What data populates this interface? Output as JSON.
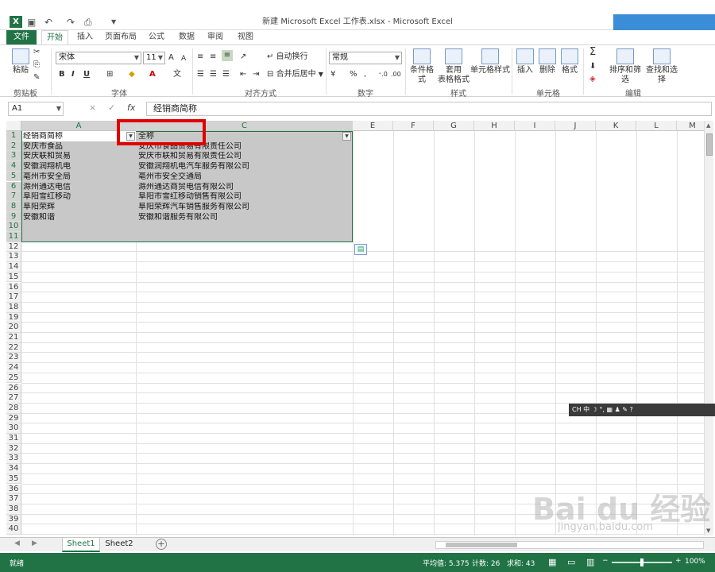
{
  "window": {
    "title": "新建 Microsoft Excel 工作表.xlsx - Microsoft Excel",
    "app_logo": "X"
  },
  "qat": {
    "save_icon": "save-icon",
    "undo_icon": "undo-icon",
    "redo_icon": "redo-icon",
    "menu_arrow": "▼"
  },
  "tabs": [
    "文件",
    "开始",
    "插入",
    "页面布局",
    "公式",
    "数据",
    "审阅",
    "视图"
  ],
  "ribbon": {
    "clipboard": {
      "paste": "粘贴",
      "label": "剪贴板"
    },
    "font": {
      "name": "宋体",
      "size": "11",
      "label": "字体",
      "bold": "B",
      "italic": "I",
      "underline": "U",
      "grow": "A",
      "shrink": "A"
    },
    "align": {
      "wrap": "自动换行",
      "merge": "合并后居中",
      "label": "对齐方式"
    },
    "number": {
      "format": "常规",
      "percent": "%",
      "comma": ",",
      "label": "数字"
    },
    "styles": {
      "cond": "条件格式",
      "table_line1": "套用",
      "table_line2": "表格格式",
      "cell": "单元格样式",
      "label": "样式"
    },
    "cells": {
      "insert": "插入",
      "delete": "删除",
      "format": "格式",
      "label": "单元格"
    },
    "editing": {
      "sum": "Σ",
      "sort": "排序和筛选",
      "find": "查找和选择",
      "label": "编辑"
    }
  },
  "formula_bar": {
    "name_box": "A1",
    "cancel": "×",
    "enter": "✓",
    "fx": "fx",
    "content": "经销商简称"
  },
  "columns": [
    "A",
    "C",
    "E",
    "F",
    "G",
    "H",
    "I",
    "J",
    "K",
    "L",
    "M"
  ],
  "rows": [
    "1",
    "2",
    "3",
    "4",
    "5",
    "6",
    "7",
    "8",
    "9",
    "10",
    "11",
    "12",
    "13",
    "14",
    "15",
    "16",
    "17",
    "18",
    "19",
    "20",
    "21",
    "22",
    "23",
    "24",
    "25",
    "26",
    "27",
    "28",
    "29",
    "30",
    "31",
    "32",
    "33",
    "34",
    "35",
    "36",
    "37",
    "38",
    "39",
    "40"
  ],
  "table": {
    "headers": [
      "经销商简称",
      "全称"
    ],
    "rows": [
      [
        "安庆市食品",
        "安庆市食品贸易有限责任公司"
      ],
      [
        "安庆联和贸易",
        "安庆市联和贸易有限责任公司"
      ],
      [
        "安徽润翔机电",
        "安徽润翔机电汽车服务有限公司"
      ],
      [
        "亳州市安全局",
        "亳州市安全交通局"
      ],
      [
        "滁州通达电信",
        "滁州通达商贸电信有限公司"
      ],
      [
        "阜阳雪红移动",
        "阜阳市雪红移动销售有限公司"
      ],
      [
        "阜阳荣辉",
        "阜阳荣辉汽车销售服务有限公司"
      ],
      [
        "安徽和谐",
        "安徽和谐服务有限公司"
      ]
    ]
  },
  "sheets": [
    "Sheet1",
    "Sheet2"
  ],
  "add_sheet": "+",
  "status": {
    "mode": "就绪",
    "average": "平均值: 5.375",
    "count": "计数: 26",
    "sum": "求和: 43",
    "zoom": "100%",
    "zoom_level": 1.0
  },
  "ime": "CH 中 ☽ °, ▦ ♟ ✎ ?",
  "watermark": {
    "main": "Bai du 经验",
    "sub": "jingyan.baidu.com"
  },
  "colors": {
    "excel_green": "#217346",
    "highlight_red": "#e00000",
    "selection_gray": "#c8c8c8"
  }
}
